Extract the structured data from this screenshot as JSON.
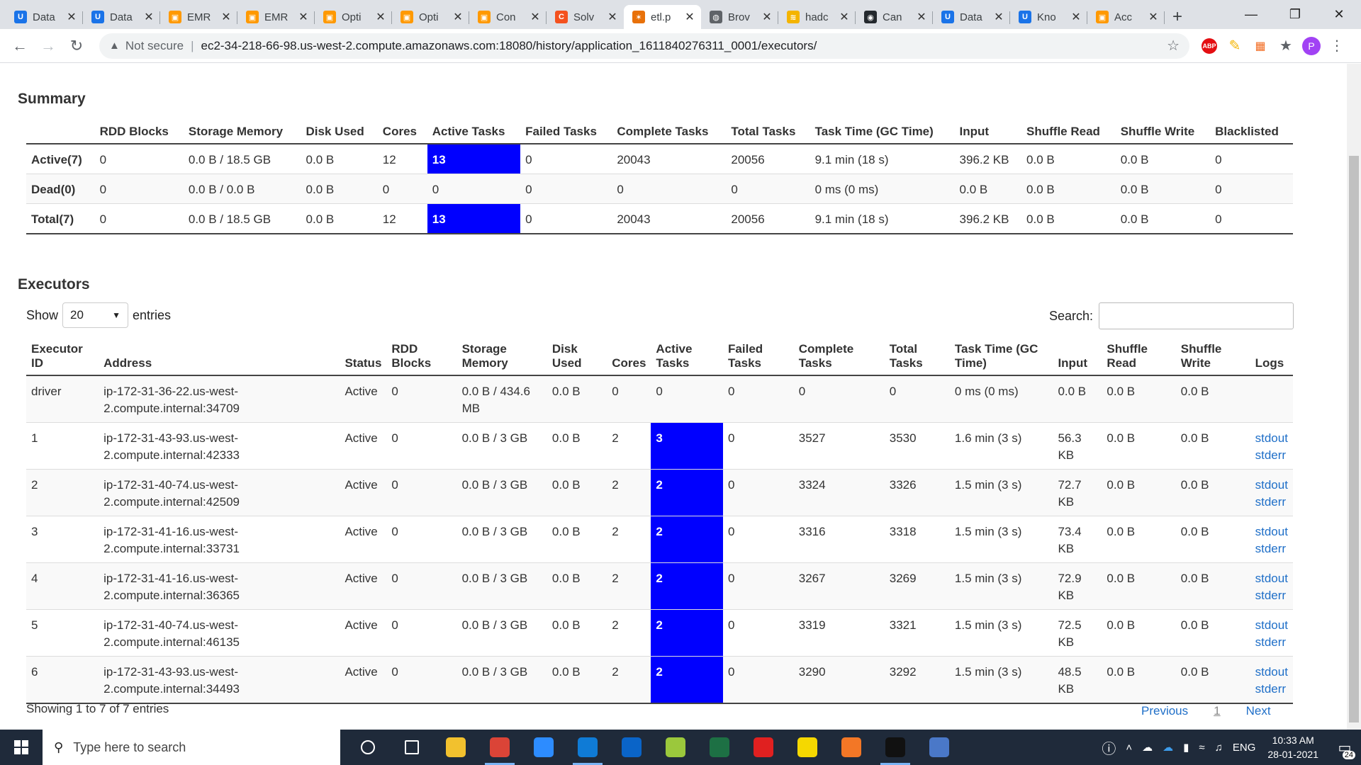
{
  "browser": {
    "tabs": [
      {
        "title": "Data",
        "color": "#1a73e8",
        "glyph": "U"
      },
      {
        "title": "Data",
        "color": "#1a73e8",
        "glyph": "U"
      },
      {
        "title": "EMR",
        "color": "#ff9900",
        "glyph": "▣"
      },
      {
        "title": "EMR",
        "color": "#ff9900",
        "glyph": "▣"
      },
      {
        "title": "Opti",
        "color": "#ff9900",
        "glyph": "▣"
      },
      {
        "title": "Opti",
        "color": "#ff9900",
        "glyph": "▣"
      },
      {
        "title": "Con",
        "color": "#ff9900",
        "glyph": "▣"
      },
      {
        "title": "Solv",
        "color": "#f4511e",
        "glyph": "C"
      },
      {
        "title": "etl.p",
        "color": "#e8710a",
        "glyph": "✶"
      },
      {
        "title": "Brov",
        "color": "#5f6368",
        "glyph": "◍"
      },
      {
        "title": "hadc",
        "color": "#f4b400",
        "glyph": "≋"
      },
      {
        "title": "Can",
        "color": "#24292e",
        "glyph": "◉"
      },
      {
        "title": "Data",
        "color": "#1a73e8",
        "glyph": "U"
      },
      {
        "title": "Kno",
        "color": "#1a73e8",
        "glyph": "U"
      },
      {
        "title": "Acc",
        "color": "#ff9900",
        "glyph": "▣"
      }
    ],
    "active_tab_index": 8,
    "security_label": "Not secure",
    "url": "ec2-34-218-66-98.us-west-2.compute.amazonaws.com:18080/history/application_1611840276311_0001/executors/",
    "profile_initial": "P",
    "abp_label": "ABP"
  },
  "summary": {
    "title": "Summary",
    "headers": [
      "",
      "RDD Blocks",
      "Storage Memory",
      "Disk Used",
      "Cores",
      "Active Tasks",
      "Failed Tasks",
      "Complete Tasks",
      "Total Tasks",
      "Task Time (GC Time)",
      "Input",
      "Shuffle Read",
      "Shuffle Write",
      "Blacklisted"
    ],
    "rows": [
      [
        "Active(7)",
        "0",
        "0.0 B / 18.5 GB",
        "0.0 B",
        "12",
        "13",
        "0",
        "20043",
        "20056",
        "9.1 min (18 s)",
        "396.2 KB",
        "0.0 B",
        "0.0 B",
        "0"
      ],
      [
        "Dead(0)",
        "0",
        "0.0 B / 0.0 B",
        "0.0 B",
        "0",
        "0",
        "0",
        "0",
        "0",
        "0 ms (0 ms)",
        "0.0 B",
        "0.0 B",
        "0.0 B",
        "0"
      ],
      [
        "Total(7)",
        "0",
        "0.0 B / 18.5 GB",
        "0.0 B",
        "12",
        "13",
        "0",
        "20043",
        "20056",
        "9.1 min (18 s)",
        "396.2 KB",
        "0.0 B",
        "0.0 B",
        "0"
      ]
    ],
    "highlight_color": "#0000ff"
  },
  "executors": {
    "title": "Executors",
    "show_label": "Show",
    "entries_label": "entries",
    "page_size": "20",
    "search_label": "Search:",
    "headers": [
      "Executor ID",
      "Address",
      "Status",
      "RDD Blocks",
      "Storage Memory",
      "Disk Used",
      "Cores",
      "Active Tasks",
      "Failed Tasks",
      "Complete Tasks",
      "Total Tasks",
      "Task Time (GC Time)",
      "Input",
      "Shuffle Read",
      "Shuffle Write",
      "Logs"
    ],
    "rows": [
      {
        "cells": [
          "driver",
          "ip-172-31-36-22.us-west-2.compute.internal:34709",
          "Active",
          "0",
          "0.0 B / 434.6 MB",
          "0.0 B",
          "0",
          "0",
          "0",
          "0",
          "0",
          "0 ms (0 ms)",
          "0.0 B",
          "0.0 B",
          "0.0 B"
        ],
        "logs": [],
        "hl": false
      },
      {
        "cells": [
          "1",
          "ip-172-31-43-93.us-west-2.compute.internal:42333",
          "Active",
          "0",
          "0.0 B / 3 GB",
          "0.0 B",
          "2",
          "3",
          "0",
          "3527",
          "3530",
          "1.6 min (3 s)",
          "56.3 KB",
          "0.0 B",
          "0.0 B"
        ],
        "logs": [
          "stdout",
          "stderr"
        ],
        "hl": true
      },
      {
        "cells": [
          "2",
          "ip-172-31-40-74.us-west-2.compute.internal:42509",
          "Active",
          "0",
          "0.0 B / 3 GB",
          "0.0 B",
          "2",
          "2",
          "0",
          "3324",
          "3326",
          "1.5 min (3 s)",
          "72.7 KB",
          "0.0 B",
          "0.0 B"
        ],
        "logs": [
          "stdout",
          "stderr"
        ],
        "hl": true
      },
      {
        "cells": [
          "3",
          "ip-172-31-41-16.us-west-2.compute.internal:33731",
          "Active",
          "0",
          "0.0 B / 3 GB",
          "0.0 B",
          "2",
          "2",
          "0",
          "3316",
          "3318",
          "1.5 min (3 s)",
          "73.4 KB",
          "0.0 B",
          "0.0 B"
        ],
        "logs": [
          "stdout",
          "stderr"
        ],
        "hl": true
      },
      {
        "cells": [
          "4",
          "ip-172-31-41-16.us-west-2.compute.internal:36365",
          "Active",
          "0",
          "0.0 B / 3 GB",
          "0.0 B",
          "2",
          "2",
          "0",
          "3267",
          "3269",
          "1.5 min (3 s)",
          "72.9 KB",
          "0.0 B",
          "0.0 B"
        ],
        "logs": [
          "stdout",
          "stderr"
        ],
        "hl": true
      },
      {
        "cells": [
          "5",
          "ip-172-31-40-74.us-west-2.compute.internal:46135",
          "Active",
          "0",
          "0.0 B / 3 GB",
          "0.0 B",
          "2",
          "2",
          "0",
          "3319",
          "3321",
          "1.5 min (3 s)",
          "72.5 KB",
          "0.0 B",
          "0.0 B"
        ],
        "logs": [
          "stdout",
          "stderr"
        ],
        "hl": true
      },
      {
        "cells": [
          "6",
          "ip-172-31-43-93.us-west-2.compute.internal:34493",
          "Active",
          "0",
          "0.0 B / 3 GB",
          "0.0 B",
          "2",
          "2",
          "0",
          "3290",
          "3292",
          "1.5 min (3 s)",
          "48.5 KB",
          "0.0 B",
          "0.0 B"
        ],
        "logs": [
          "stdout",
          "stderr"
        ],
        "hl": true
      }
    ],
    "info": "Showing 1 to 7 of 7 entries",
    "pager": {
      "previous": "Previous",
      "current": "1",
      "next": "Next"
    }
  },
  "taskbar": {
    "search_placeholder": "Type here to search",
    "apps": [
      {
        "name": "cortana-icon",
        "color": "transparent"
      },
      {
        "name": "task-view-icon",
        "color": "transparent"
      },
      {
        "name": "file-explorer-icon",
        "color": "#f2c12e"
      },
      {
        "name": "chrome-icon",
        "color": "#db4437"
      },
      {
        "name": "zoom-icon",
        "color": "#2d8cff"
      },
      {
        "name": "edge-icon",
        "color": "#0f7bd6"
      },
      {
        "name": "outlook-icon",
        "color": "#0a64c8"
      },
      {
        "name": "notepad-plus-icon",
        "color": "#9bc83c"
      },
      {
        "name": "excel-icon",
        "color": "#1d7044"
      },
      {
        "name": "acrobat-icon",
        "color": "#e02020"
      },
      {
        "name": "sticky-notes-icon",
        "color": "#f5d800"
      },
      {
        "name": "jupyter-icon",
        "color": "#f37726"
      },
      {
        "name": "terminal-icon",
        "color": "#111111"
      },
      {
        "name": "network-app-icon",
        "color": "#4a78c8"
      }
    ],
    "language": "ENG",
    "time": "10:33 AM",
    "date": "28-01-2021",
    "notification_count": "24"
  }
}
